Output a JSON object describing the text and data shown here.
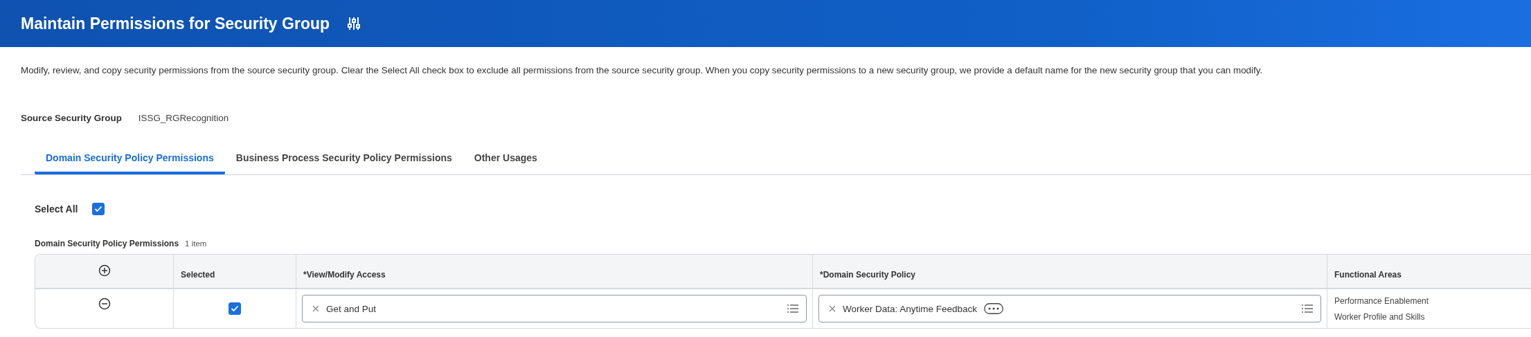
{
  "header": {
    "title": "Maintain Permissions for Security Group"
  },
  "description": "Modify, review, and copy security permissions from the source security group. Clear the Select All check box to exclude all permissions from the source security group. When you copy security permissions to a new security group, we provide a default name for the new security group that you can modify.",
  "source_security_group": {
    "label": "Source Security Group",
    "value": "ISSG_RGRecognition"
  },
  "tabs": [
    {
      "label": "Domain Security Policy Permissions",
      "selected": true
    },
    {
      "label": "Business Process Security Policy Permissions",
      "selected": false
    },
    {
      "label": "Other Usages",
      "selected": false
    }
  ],
  "select_all": {
    "label": "Select All",
    "checked": true
  },
  "table": {
    "title": "Domain Security Policy Permissions",
    "count": "1 item",
    "columns": [
      "Selected",
      "*View/Modify Access",
      "*Domain Security Policy",
      "Functional Areas"
    ],
    "rows": [
      {
        "checked": true,
        "view_modify_access": "Get and Put",
        "domain_security_policy": "Worker Data: Anytime Feedback",
        "functional_areas": [
          "Performance Enablement",
          "Worker Profile and Skills"
        ]
      }
    ]
  }
}
